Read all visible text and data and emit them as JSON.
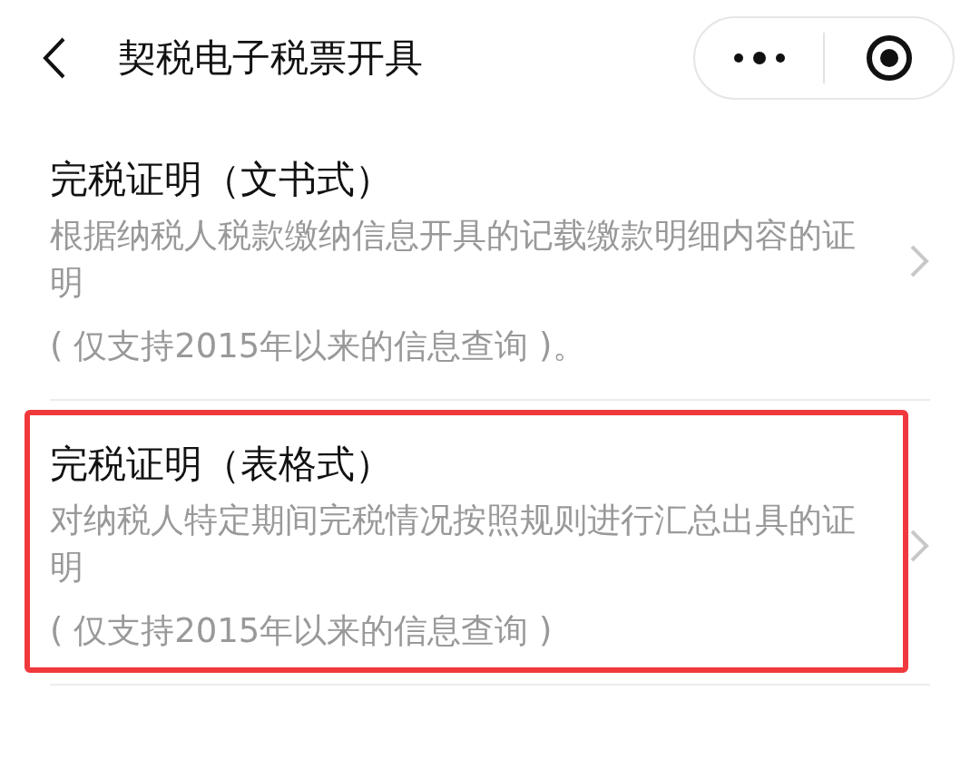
{
  "header": {
    "title": "契税电子税票开具"
  },
  "items": [
    {
      "title": "完税证明（文书式）",
      "description": "根据纳税人税款缴纳信息开具的记载缴款明细内容的证明",
      "note": "( 仅支持2015年以来的信息查询 )。",
      "highlighted": false
    },
    {
      "title": "完税证明（表格式）",
      "description": "对纳税人特定期间完税情况按照规则进行汇总出具的证明",
      "note": "( 仅支持2015年以来的信息查询 )",
      "highlighted": true
    }
  ]
}
